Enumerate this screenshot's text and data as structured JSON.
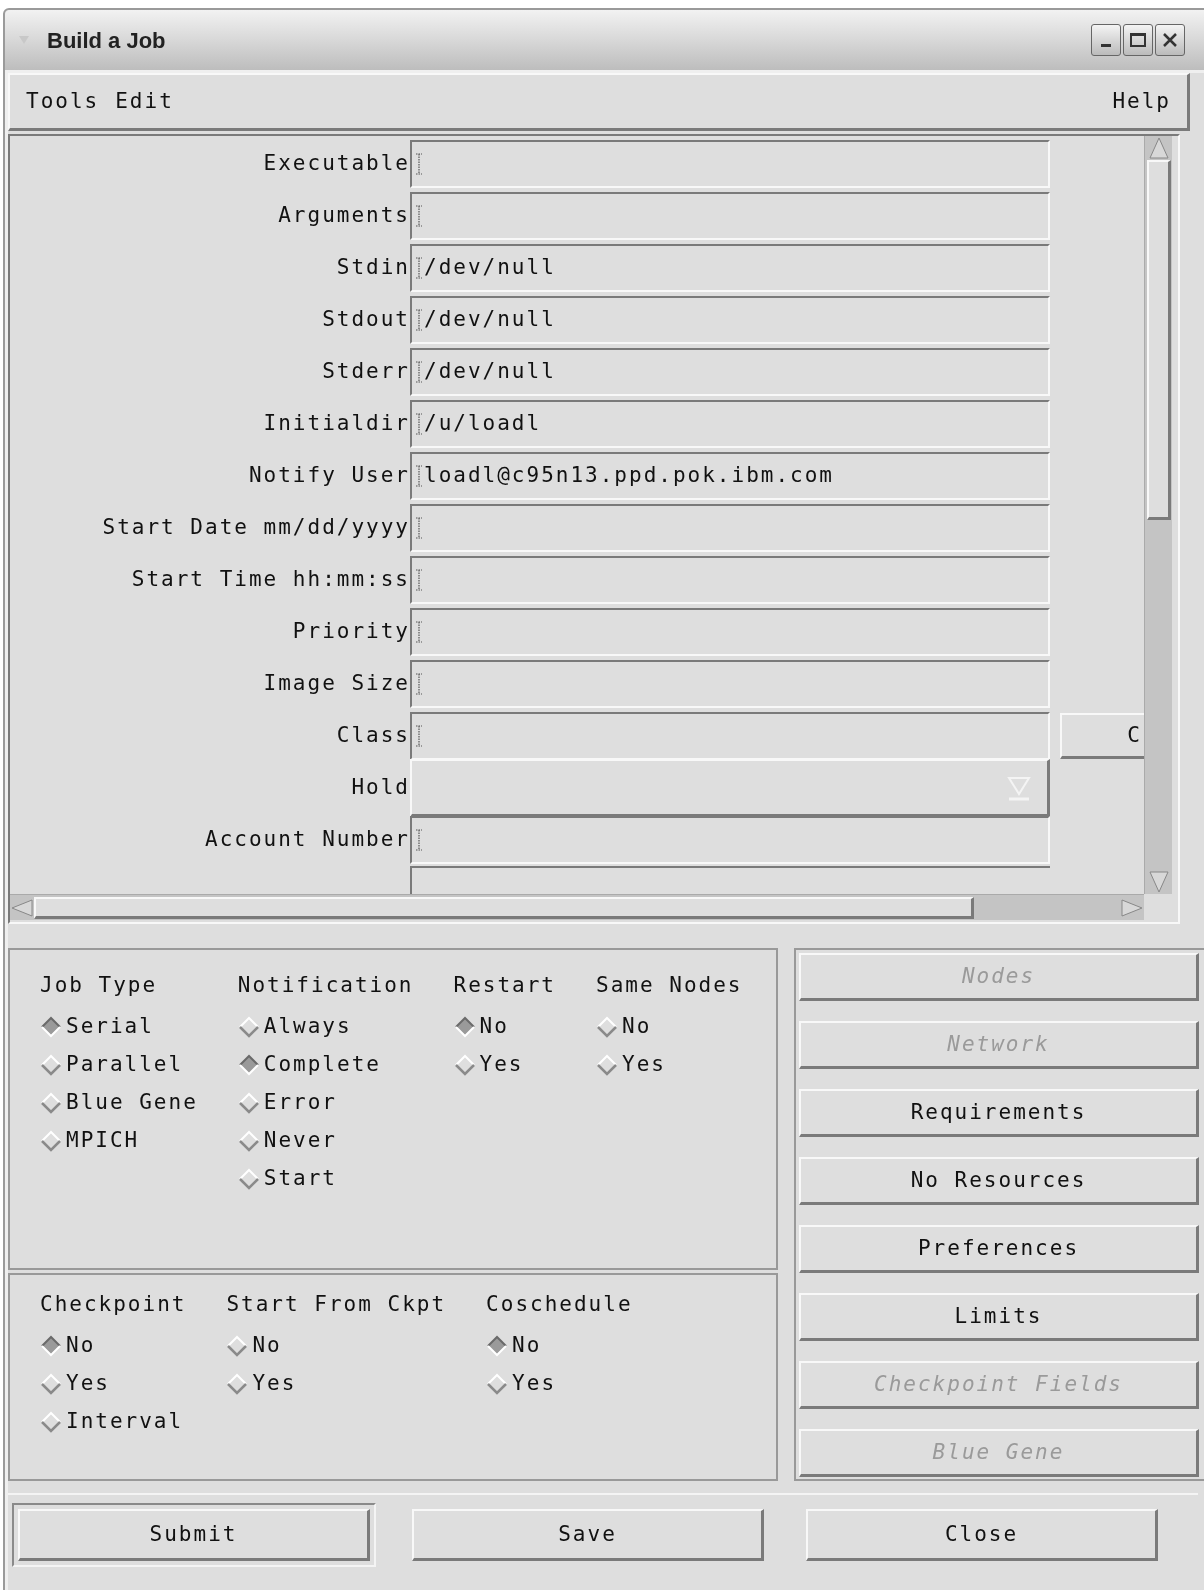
{
  "window": {
    "title": "Build a Job"
  },
  "menu_bar": {
    "left": [
      {
        "label": "Tools"
      },
      {
        "label": "Edit"
      }
    ],
    "right": [
      {
        "label": "Help"
      }
    ]
  },
  "fields": [
    {
      "label": "Executable",
      "kind": "text"
    },
    {
      "label": "Arguments",
      "kind": "text"
    },
    {
      "label": "Stdin",
      "value": "/dev/null",
      "kind": "text"
    },
    {
      "label": "Stdout",
      "value": "/dev/null",
      "kind": "text"
    },
    {
      "label": "Stderr",
      "value": "/dev/null",
      "kind": "text"
    },
    {
      "label": "Initialdir",
      "value": "/u/loadl",
      "kind": "text"
    },
    {
      "label": "Notify User",
      "value": "loadl@c95n13.ppd.pok.ibm.com",
      "kind": "text"
    },
    {
      "label": "Start Date mm/dd/yyyy",
      "kind": "text"
    },
    {
      "label": "Start Time hh:mm:ss",
      "kind": "text"
    },
    {
      "label": "Priority",
      "kind": "text"
    },
    {
      "label": "Image Size",
      "kind": "text"
    },
    {
      "label": "Class",
      "kind": "text",
      "side_button": "C"
    },
    {
      "label": "Hold",
      "kind": "dropdown"
    },
    {
      "label": "Account Number",
      "kind": "text"
    }
  ],
  "option_panels": [
    {
      "groups": [
        {
          "title": "Job Type",
          "options": [
            {
              "label": "Serial",
              "selected": true
            },
            {
              "label": "Parallel",
              "selected": false
            },
            {
              "label": "Blue Gene",
              "selected": false
            },
            {
              "label": "MPICH",
              "selected": false
            }
          ]
        },
        {
          "title": "Notification",
          "options": [
            {
              "label": "Always",
              "selected": false
            },
            {
              "label": "Complete",
              "selected": true
            },
            {
              "label": "Error",
              "selected": false
            },
            {
              "label": "Never",
              "selected": false
            },
            {
              "label": "Start",
              "selected": false
            }
          ]
        },
        {
          "title": "Restart",
          "options": [
            {
              "label": "No",
              "selected": true
            },
            {
              "label": "Yes",
              "selected": false
            }
          ]
        },
        {
          "title": "Same Nodes",
          "options": [
            {
              "label": "No",
              "selected": false
            },
            {
              "label": "Yes",
              "selected": false
            }
          ]
        }
      ]
    },
    {
      "groups": [
        {
          "title": "Checkpoint",
          "options": [
            {
              "label": "No",
              "selected": true
            },
            {
              "label": "Yes",
              "selected": false
            },
            {
              "label": "Interval",
              "selected": false
            }
          ]
        },
        {
          "title": "Start From Ckpt",
          "options": [
            {
              "label": "No",
              "selected": false
            },
            {
              "label": "Yes",
              "selected": false
            }
          ]
        },
        {
          "title": "Coschedule",
          "options": [
            {
              "label": "No",
              "selected": true
            },
            {
              "label": "Yes",
              "selected": false
            }
          ]
        }
      ]
    }
  ],
  "side_buttons": [
    {
      "label": "Nodes",
      "disabled": true
    },
    {
      "label": "Network",
      "disabled": true
    },
    {
      "label": "Requirements",
      "disabled": false
    },
    {
      "label": "No Resources",
      "disabled": false
    },
    {
      "label": "Preferences",
      "disabled": false
    },
    {
      "label": "Limits",
      "disabled": false
    },
    {
      "label": "Checkpoint Fields",
      "disabled": true
    },
    {
      "label": "Blue Gene",
      "disabled": true
    }
  ],
  "bottom_buttons": [
    {
      "label": "Submit",
      "default": true
    },
    {
      "label": "Save",
      "default": false
    },
    {
      "label": "Close",
      "default": false
    }
  ]
}
